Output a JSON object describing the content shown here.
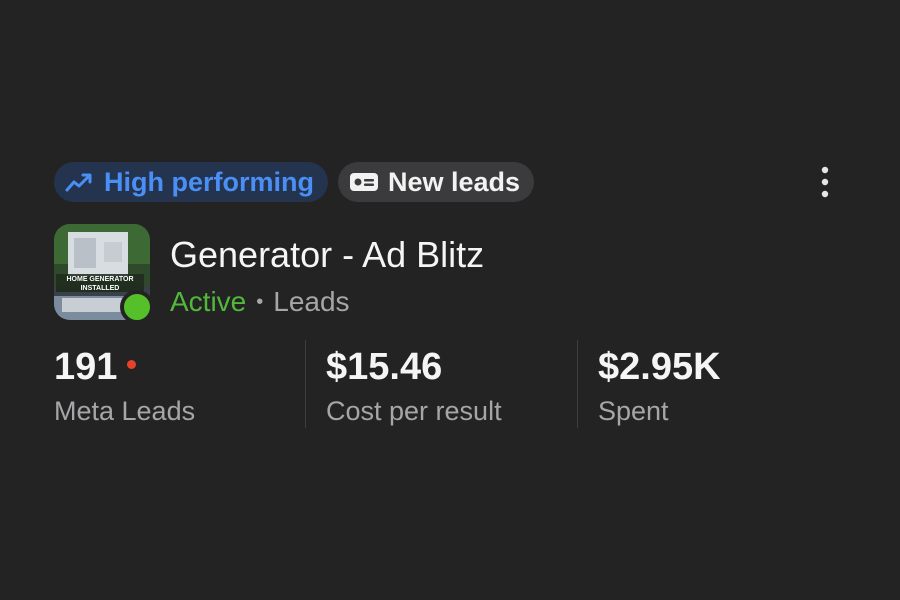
{
  "badges": {
    "high_performing": {
      "label": "High performing",
      "icon": "trending-up-icon",
      "color": "#4a8ff5"
    },
    "new_leads": {
      "label": "New leads",
      "icon": "lead-card-icon"
    }
  },
  "more_menu_icon": "more-vertical-icon",
  "ad": {
    "title": "Generator - Ad Blitz",
    "status": "Active",
    "status_color": "#52b83a",
    "separator": "•",
    "objective": "Leads",
    "thumbnail_text": [
      "HOME GENERATOR",
      "INSTALLED"
    ]
  },
  "metrics": [
    {
      "value": "191",
      "label": "Meta Leads",
      "alert": true
    },
    {
      "value": "$15.46",
      "label": "Cost per result"
    },
    {
      "value": "$2.95K",
      "label": "Spent"
    }
  ]
}
